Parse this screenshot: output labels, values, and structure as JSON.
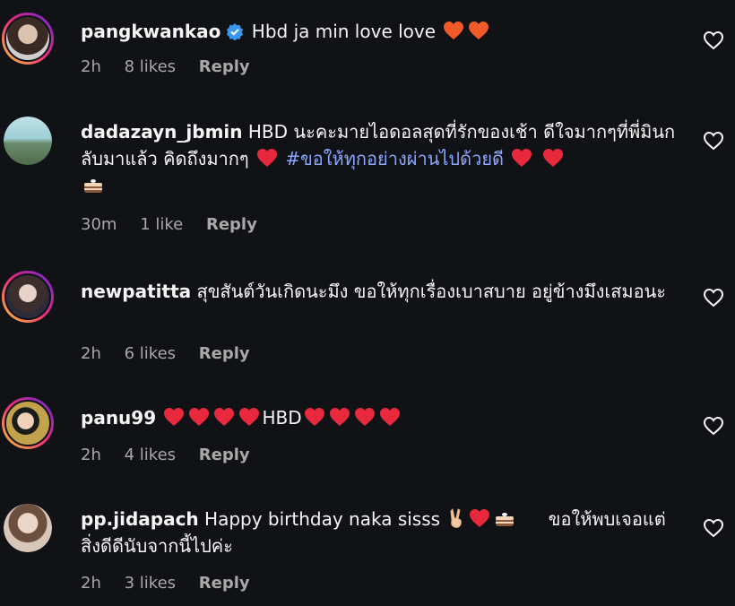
{
  "comments": [
    {
      "username": "pangkwankao",
      "verified": true,
      "text": "Hbd ja min love love",
      "time": "2h",
      "likes": "8 likes",
      "reply": "Reply"
    },
    {
      "username": "dadazayn_jbmin",
      "text": "HBD นะคะมายไอดอลสุดที่รักของเช้า ดีใจมากๆที่พี่มินกลับมาแล้ว คิดถึงมากๆ",
      "hashtag": "#ขอให้ทุกอย่างผ่านไปด้วยดี",
      "time": "30m",
      "likes": "1 like",
      "reply": "Reply"
    },
    {
      "username": "newpatitta",
      "text": "สุขสันต์วันเกิดนะมึง ขอให้ทุกเรื่องเบาสบาย อยู่ข้างมึงเสมอนะ",
      "time": "2h",
      "likes": "6 likes",
      "reply": "Reply"
    },
    {
      "username": "panu99",
      "text": "HBD",
      "time": "2h",
      "likes": "4 likes",
      "reply": "Reply"
    },
    {
      "username": "pp.jidapach",
      "text": "Happy birthday naka sisss",
      "text2": "ขอให้พบเจอแต่สิ่งดีดีนับจากนี้ไปค่ะ",
      "time": "2h",
      "likes": "3 likes",
      "reply": "Reply"
    }
  ],
  "icons": {
    "heart": "heart-outline-icon",
    "verified": "verified-badge-icon",
    "red_heart": "red-heart-emoji",
    "cake": "cake-emoji",
    "peace": "victory-hand-emoji"
  },
  "colors": {
    "background": "#111216",
    "text": "#f5f5f5",
    "meta": "#a8a8a8",
    "hashtag": "#8aa6ff",
    "verified": "#3897f0",
    "heart_emoji": "#e0245e"
  }
}
